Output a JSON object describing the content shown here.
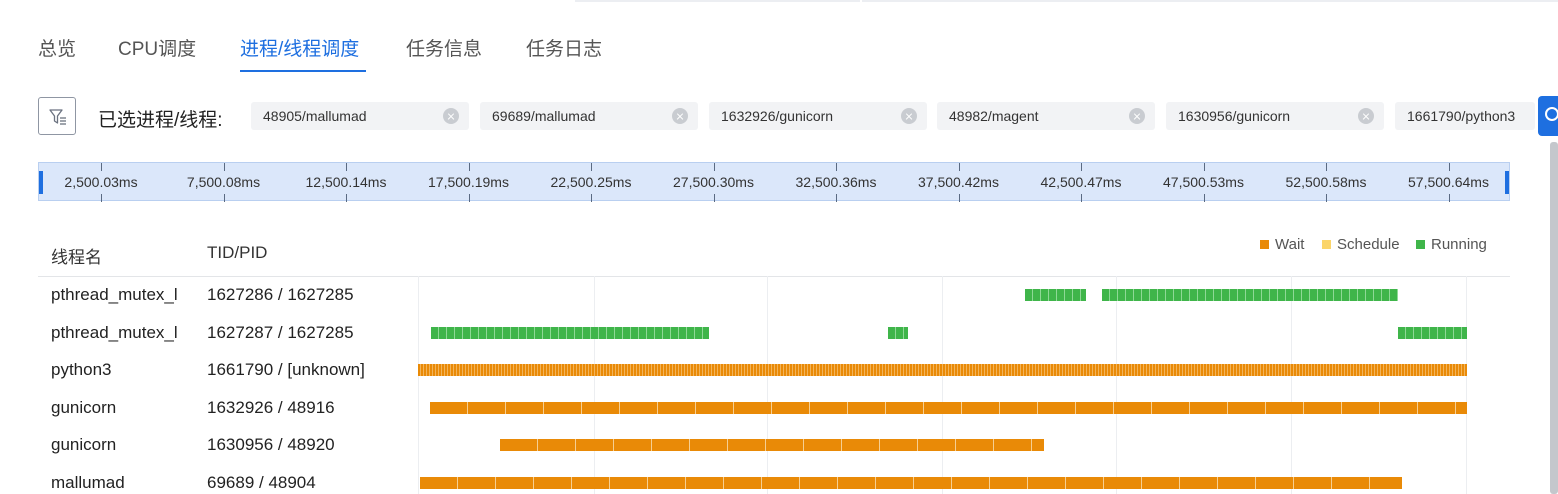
{
  "tabs": [
    "总览",
    "CPU调度",
    "进程/线程调度",
    "任务信息",
    "任务日志"
  ],
  "active_tab": 2,
  "filter": {
    "label": "已选进程/线程:",
    "chips": [
      "48905/mallumad",
      "69689/mallumad",
      "1632926/gunicorn",
      "48982/magent",
      "1630956/gunicorn",
      "1661790/python3"
    ]
  },
  "time_axis": {
    "unit": "ms",
    "ticks": [
      "2,500.03ms",
      "7,500.08ms",
      "12,500.14ms",
      "17,500.19ms",
      "22,500.25ms",
      "27,500.30ms",
      "32,500.36ms",
      "37,500.42ms",
      "42,500.47ms",
      "47,500.53ms",
      "52,500.58ms",
      "57,500.64ms"
    ]
  },
  "table": {
    "headers": {
      "name": "线程名",
      "tid": "TID/PID"
    },
    "rows": [
      {
        "name": "pthread_mutex_l",
        "tid": "1627286 / 1627285"
      },
      {
        "name": "pthread_mutex_l",
        "tid": "1627287 / 1627285"
      },
      {
        "name": "python3",
        "tid": "1661790 / [unknown]"
      },
      {
        "name": "gunicorn",
        "tid": "1632926 / 48916"
      },
      {
        "name": "gunicorn",
        "tid": "1630956 / 48920"
      },
      {
        "name": "mallumad",
        "tid": "69689 / 48904"
      }
    ]
  },
  "legend": [
    {
      "label": "Wait",
      "color": "#e98a07"
    },
    {
      "label": "Schedule",
      "color": "#fbd56a"
    },
    {
      "label": "Running",
      "color": "#3fb54a"
    }
  ],
  "colors": {
    "accent": "#1e6fe0",
    "wait": "#e98a07",
    "schedule": "#fbd56a",
    "running": "#3fb54a"
  },
  "timeline_segments_ms": [
    {
      "row": 0,
      "state": "Running",
      "segments": [
        [
          32700,
          36000
        ],
        [
          36850,
          52800
        ]
      ]
    },
    {
      "row": 1,
      "state": "Running",
      "segments": [
        [
          700,
          15700
        ],
        [
          25300,
          26400
        ],
        [
          52800,
          56500
        ]
      ]
    },
    {
      "row": 2,
      "state": "Wait",
      "segments": [
        [
          0,
          56500
        ]
      ]
    },
    {
      "row": 3,
      "state": "Wait",
      "segments": [
        [
          650,
          56500
        ]
      ]
    },
    {
      "row": 4,
      "state": "Wait",
      "segments": [
        [
          4400,
          33700
        ]
      ]
    },
    {
      "row": 5,
      "state": "Wait",
      "segments": [
        [
          100,
          53000
        ]
      ]
    }
  ],
  "timeline_range_ms": [
    0,
    56500
  ]
}
